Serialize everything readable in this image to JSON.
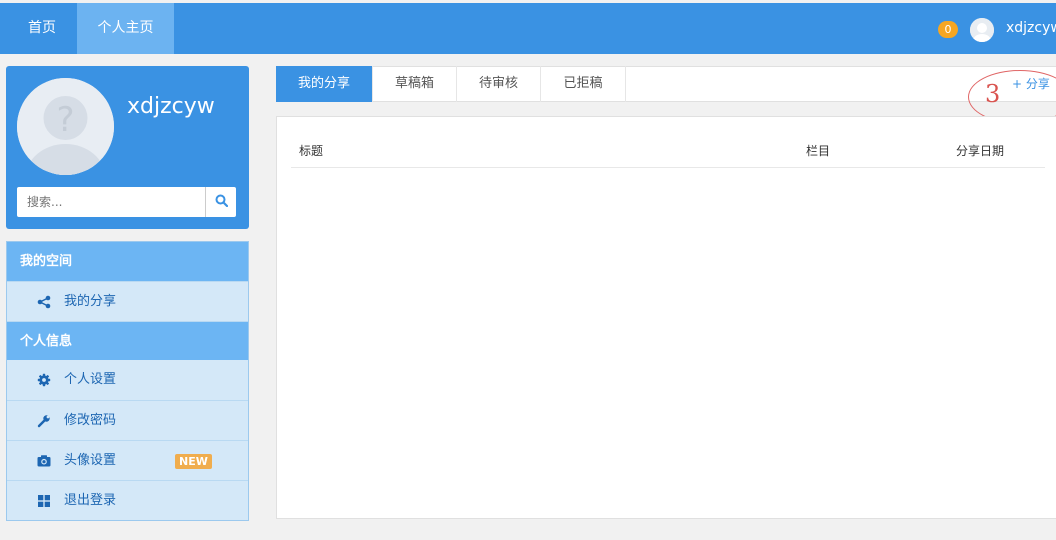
{
  "nav": {
    "home": "首页",
    "personal": "个人主页",
    "notifications": "0",
    "username": "xdjzcyw"
  },
  "profile": {
    "name": "xdjzcyw",
    "search_placeholder": "搜索..."
  },
  "menu": {
    "group1": "我的空间",
    "my_share": "我的分享",
    "group2": "个人信息",
    "settings": "个人设置",
    "password": "修改密码",
    "avatar": "头像设置",
    "new_badge": "NEW",
    "logout": "退出登录"
  },
  "tabs": {
    "my_share": "我的分享",
    "drafts": "草稿箱",
    "pending": "待审核",
    "rejected": "已拒稿"
  },
  "add_share": "+ 分享",
  "annotation": "3",
  "table": {
    "columns": [
      "标题",
      "栏目",
      "分享日期"
    ]
  },
  "colors": {
    "primary": "#3a92e3",
    "accent_light": "#6cb3f1",
    "badge": "#f5a623",
    "annotation": "#d9534f"
  }
}
